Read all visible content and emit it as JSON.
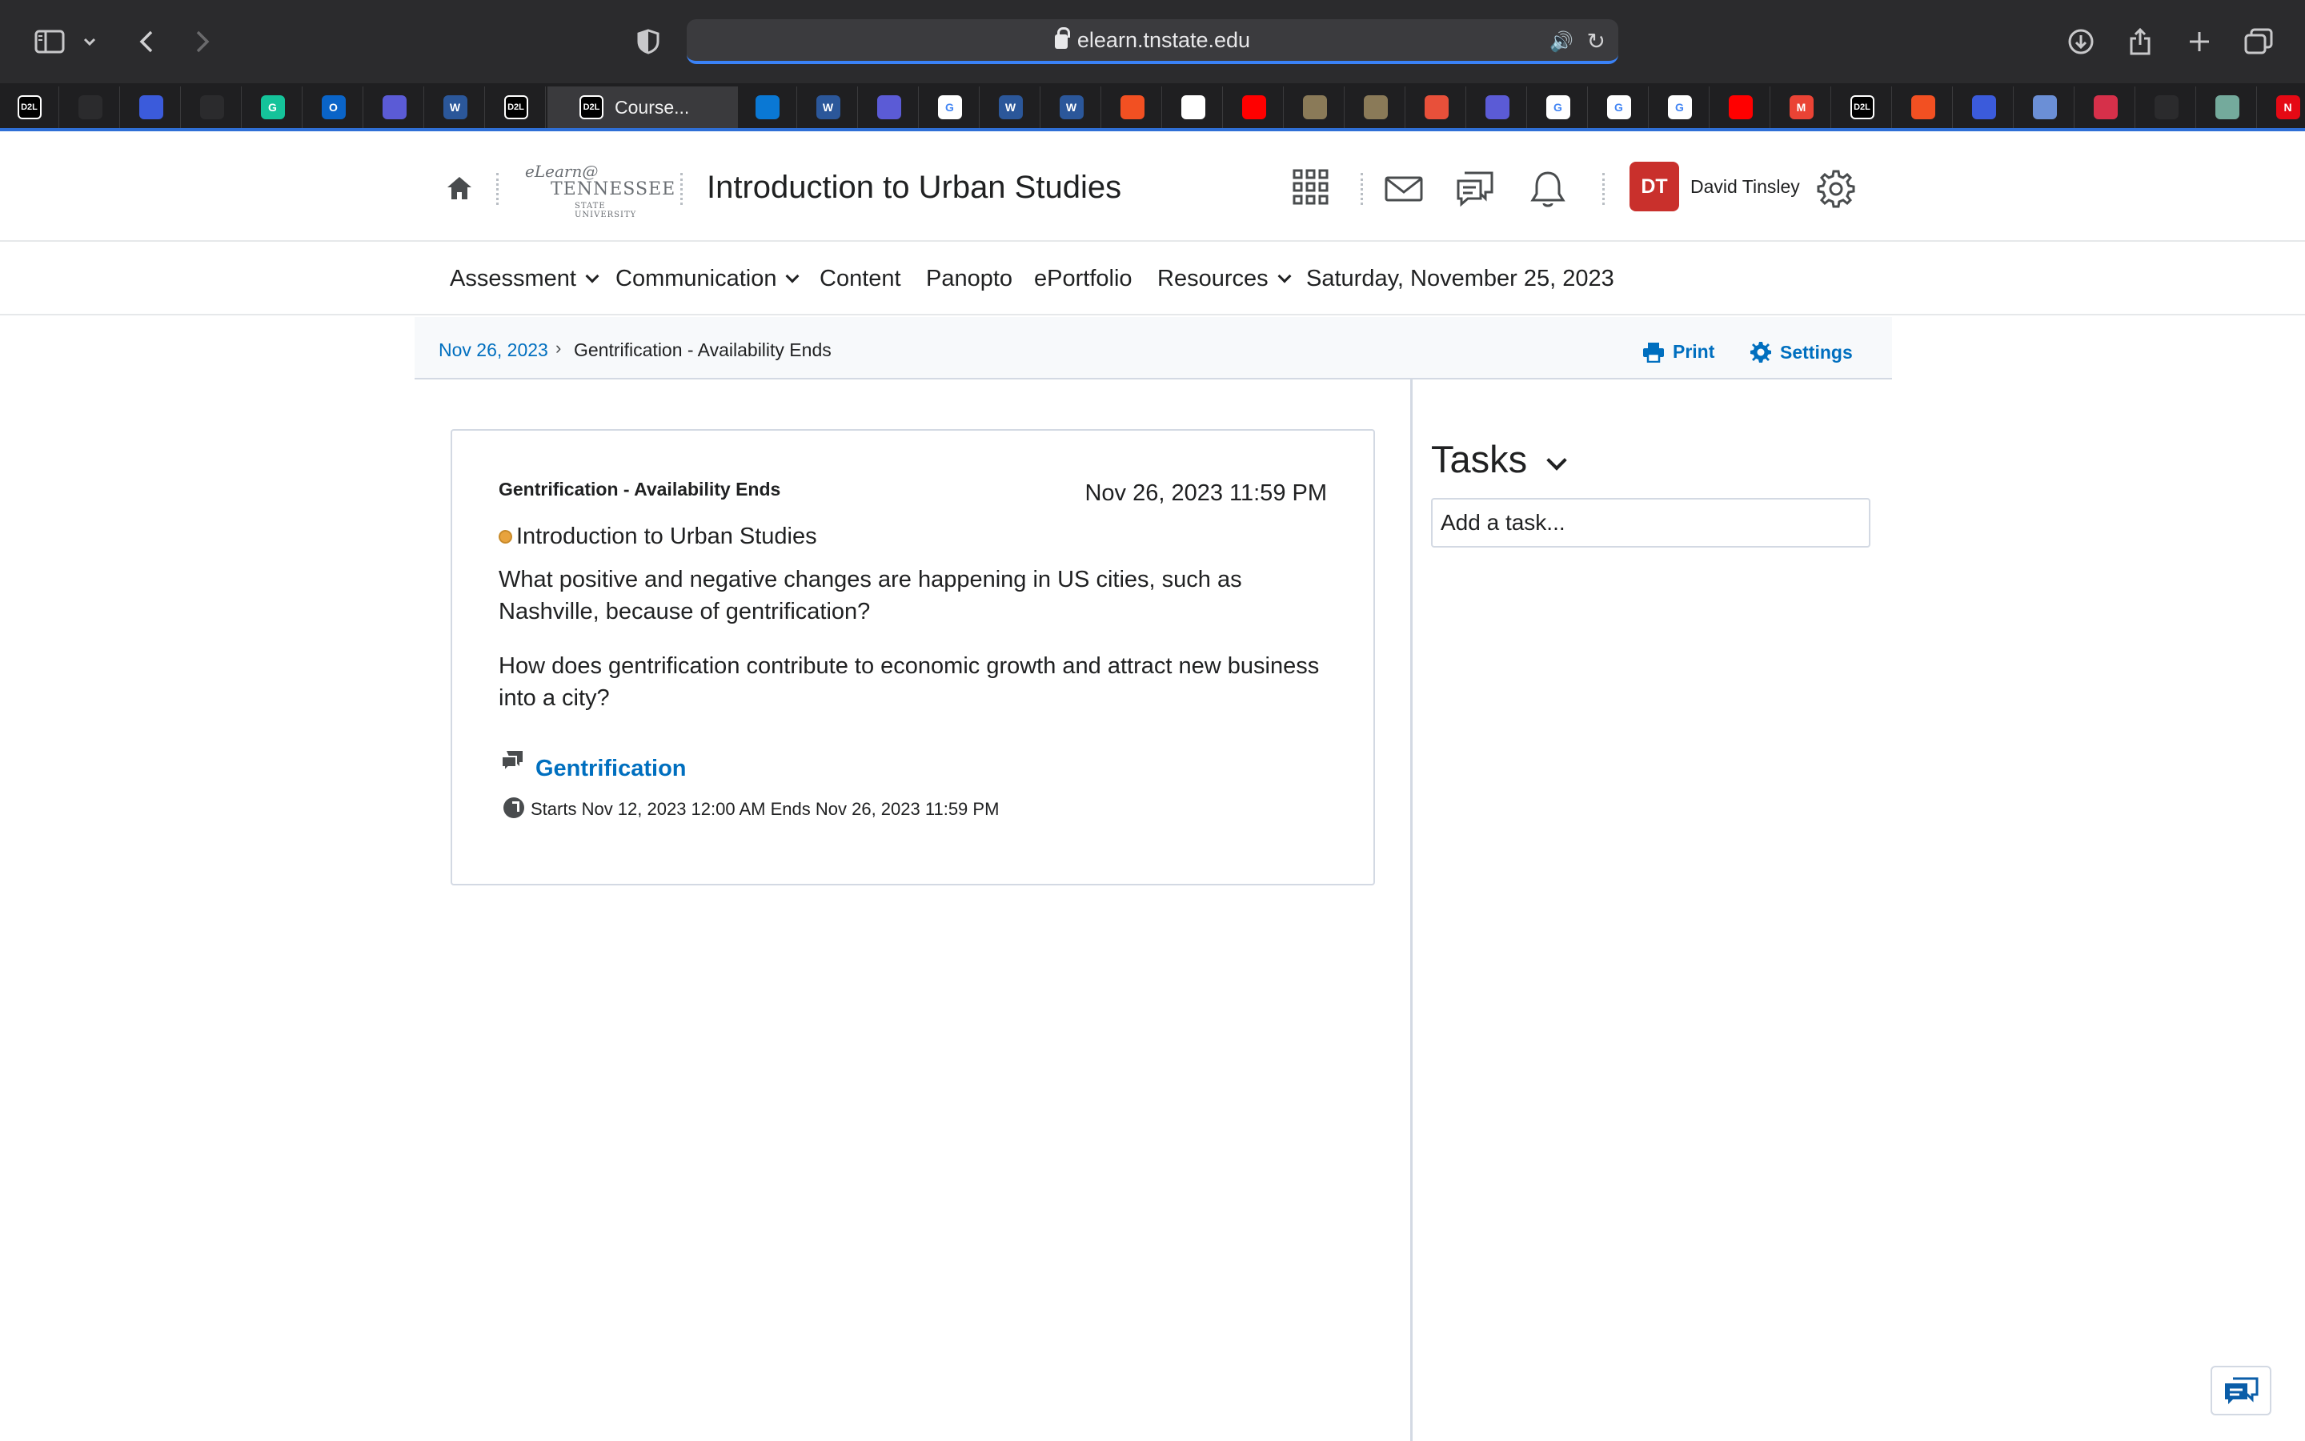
{
  "browser": {
    "url": "elearn.tnstate.edu",
    "active_tab_title": "Course...",
    "active_tab_icon_text": "D2L",
    "tabs": [
      {
        "icon": "d2l-icon",
        "text": "D2L",
        "color": "#000000"
      },
      {
        "icon": "glasses-icon",
        "text": "",
        "color": "#2b2b2d"
      },
      {
        "icon": "app-icon",
        "text": "",
        "color": "#3b5bdb"
      },
      {
        "icon": "feather-icon",
        "text": "",
        "color": "#2b2b2d"
      },
      {
        "icon": "grammarly-icon",
        "text": "G",
        "color": "#15c39a"
      },
      {
        "icon": "outlook-icon",
        "text": "O",
        "color": "#0a64c8"
      },
      {
        "icon": "play-icon",
        "text": "",
        "color": "#5b5bd6"
      },
      {
        "icon": "word-icon",
        "text": "W",
        "color": "#2b579a"
      },
      {
        "icon": "d2l-icon",
        "text": "D2L",
        "color": "#000000"
      },
      {
        "icon": "onedrive-icon",
        "text": "",
        "color": "#0a78d4"
      },
      {
        "icon": "word-icon",
        "text": "W",
        "color": "#2b579a"
      },
      {
        "icon": "play-icon",
        "text": "",
        "color": "#5b5bd6"
      },
      {
        "icon": "google-icon",
        "text": "G",
        "color": "#ffffff"
      },
      {
        "icon": "word-icon",
        "text": "W",
        "color": "#2b579a"
      },
      {
        "icon": "word-icon",
        "text": "W",
        "color": "#2b579a"
      },
      {
        "icon": "microsoft-icon",
        "text": "",
        "color": "#f25022"
      },
      {
        "icon": "app-icon",
        "text": "",
        "color": "#ffffff"
      },
      {
        "icon": "youtube-icon",
        "text": "",
        "color": "#ff0000"
      },
      {
        "icon": "seal-icon",
        "text": "",
        "color": "#8a7a58"
      },
      {
        "icon": "seal-icon",
        "text": "",
        "color": "#8a7a58"
      },
      {
        "icon": "target-icon",
        "text": "",
        "color": "#e8503a"
      },
      {
        "icon": "zoom-icon",
        "text": "",
        "color": "#5b5bd6"
      },
      {
        "icon": "google-icon",
        "text": "G",
        "color": "#ffffff"
      },
      {
        "icon": "google-icon",
        "text": "G",
        "color": "#ffffff"
      },
      {
        "icon": "google-icon",
        "text": "G",
        "color": "#ffffff"
      },
      {
        "icon": "youtube-icon",
        "text": "",
        "color": "#ff0000"
      },
      {
        "icon": "gmail-icon",
        "text": "M",
        "color": "#ea4335"
      },
      {
        "icon": "d2l-icon",
        "text": "D2L",
        "color": "#000000"
      },
      {
        "icon": "microsoft-icon",
        "text": "",
        "color": "#f25022"
      },
      {
        "icon": "app-icon",
        "text": "",
        "color": "#3b5bdb"
      },
      {
        "icon": "home-app-icon",
        "text": "",
        "color": "#6b8fd6"
      },
      {
        "icon": "heart-icon",
        "text": "",
        "color": "#d6304a"
      },
      {
        "icon": "star-icon",
        "text": "",
        "color": "#2b2b2d"
      },
      {
        "icon": "chatgpt-icon",
        "text": "",
        "color": "#74aa9c"
      },
      {
        "icon": "netflix-icon",
        "text": "N",
        "color": "#e50914"
      }
    ]
  },
  "header": {
    "course_title": "Introduction to Urban Studies",
    "logo": {
      "line1": "eLearn@",
      "line2": "TENNESSEE",
      "line3": "STATE UNIVERSITY"
    },
    "user_initials": "DT",
    "user_name": "David Tinsley"
  },
  "nav": {
    "items": [
      {
        "label": "Assessment",
        "dropdown": true
      },
      {
        "label": "Communication",
        "dropdown": true
      },
      {
        "label": "Content",
        "dropdown": false
      },
      {
        "label": "Panopto",
        "dropdown": false
      },
      {
        "label": "ePortfolio",
        "dropdown": false
      },
      {
        "label": "Resources",
        "dropdown": true
      }
    ],
    "date_text": "Saturday, November 25, 2023"
  },
  "breadcrumb": {
    "link": "Nov 26, 2023",
    "separator": "›",
    "current": "Gentrification - Availability Ends",
    "print_label": "Print",
    "settings_label": "Settings"
  },
  "event": {
    "title": "Gentrification - Availability Ends",
    "datetime": "Nov 26, 2023 11:59 PM",
    "course": "Introduction to Urban Studies",
    "paragraph1": "What positive and negative changes are happening in US cities, such as Nashville, because of gentrification?",
    "paragraph2": "How does  gentrification contribute to economic growth and attract new business into a city?",
    "topic_link": "Gentrification",
    "range": "Starts Nov 12, 2023 12:00 AM   Ends Nov 26, 2023 11:59 PM"
  },
  "tasks": {
    "title": "Tasks",
    "placeholder": "Add a task..."
  },
  "colors": {
    "link": "#006fbf",
    "avatar": "#c9302c",
    "course_dot": "#e8a33d",
    "focus": "#3a82f7"
  }
}
